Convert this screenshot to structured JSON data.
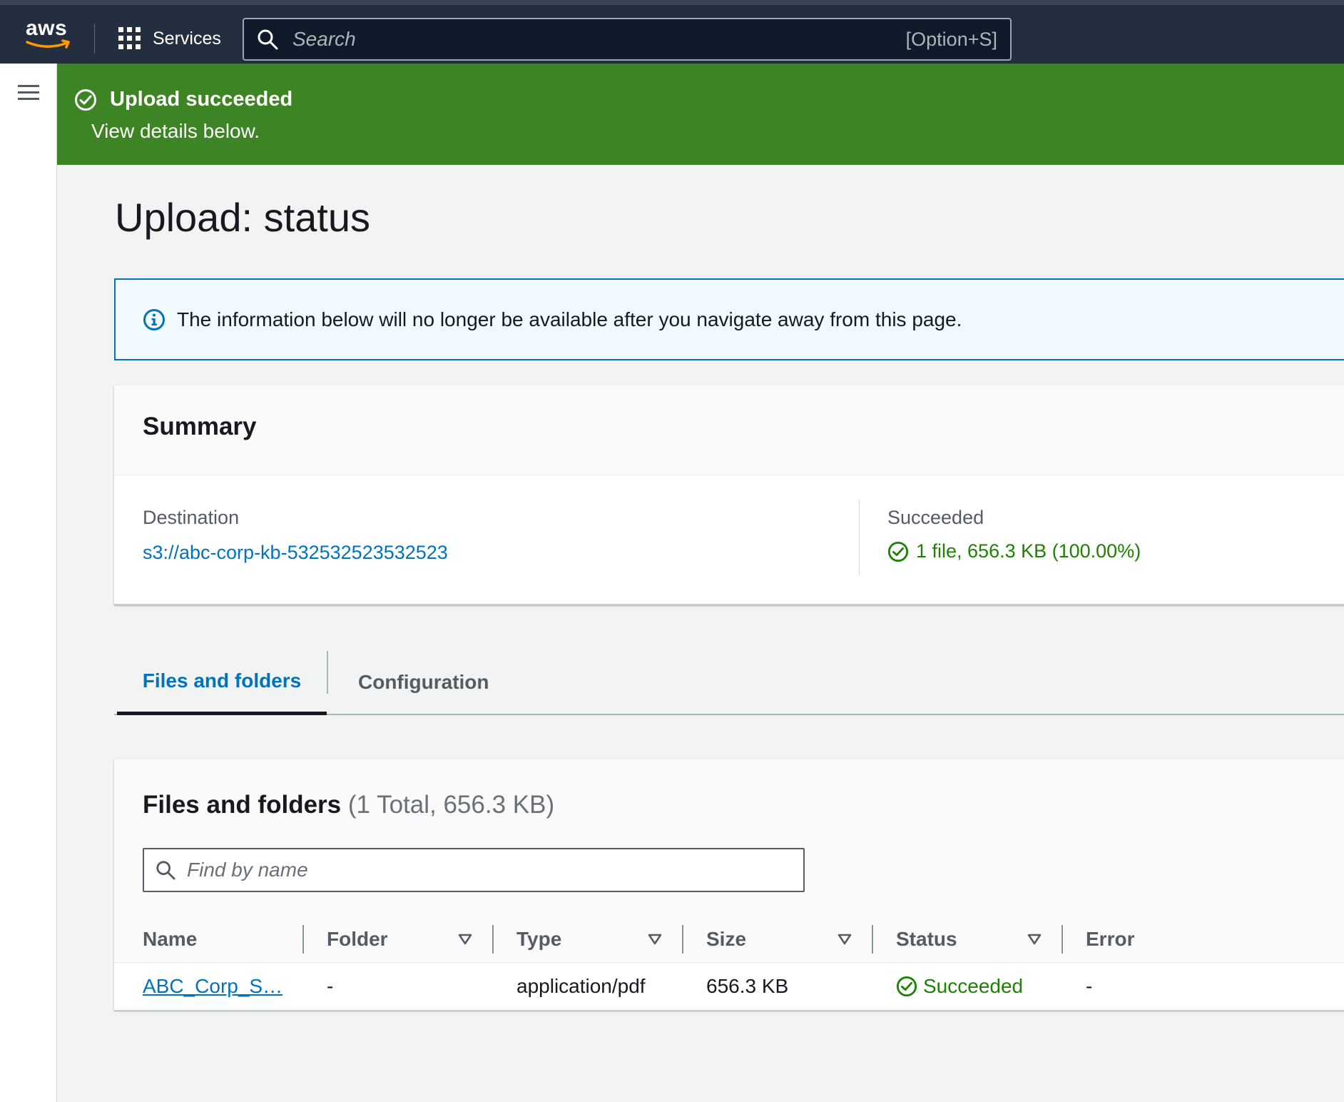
{
  "topbar": {
    "logo_text": "aws",
    "services_label": "Services",
    "search_placeholder": "Search",
    "search_shortcut": "[Option+S]"
  },
  "flash": {
    "title": "Upload succeeded",
    "subtitle": "View details below."
  },
  "page": {
    "title": "Upload: status"
  },
  "info_alert": {
    "message": "The information below will no longer be available after you navigate away from this page."
  },
  "summary": {
    "heading": "Summary",
    "destination_label": "Destination",
    "destination_value": "s3://abc-corp-kb-532532523532523",
    "succeeded_label": "Succeeded",
    "succeeded_value": "1 file, 656.3 KB (100.00%)"
  },
  "tabs": [
    {
      "label": "Files and folders",
      "active": true
    },
    {
      "label": "Configuration",
      "active": false
    }
  ],
  "files": {
    "heading": "Files and folders",
    "count": "(1 Total, 656.3 KB)",
    "find_placeholder": "Find by name",
    "columns": [
      "Name",
      "Folder",
      "Type",
      "Size",
      "Status",
      "Error"
    ],
    "rows": [
      {
        "name": "ABC_Corp_S…",
        "folder": "-",
        "type": "application/pdf",
        "size": "656.3 KB",
        "status": "Succeeded",
        "error": "-"
      }
    ]
  },
  "colors": {
    "topbar_bg": "#232f3e",
    "flash_success": "#3d8424",
    "link": "#0073bb",
    "success_text": "#1d8102",
    "info_border": "#0073bb"
  }
}
